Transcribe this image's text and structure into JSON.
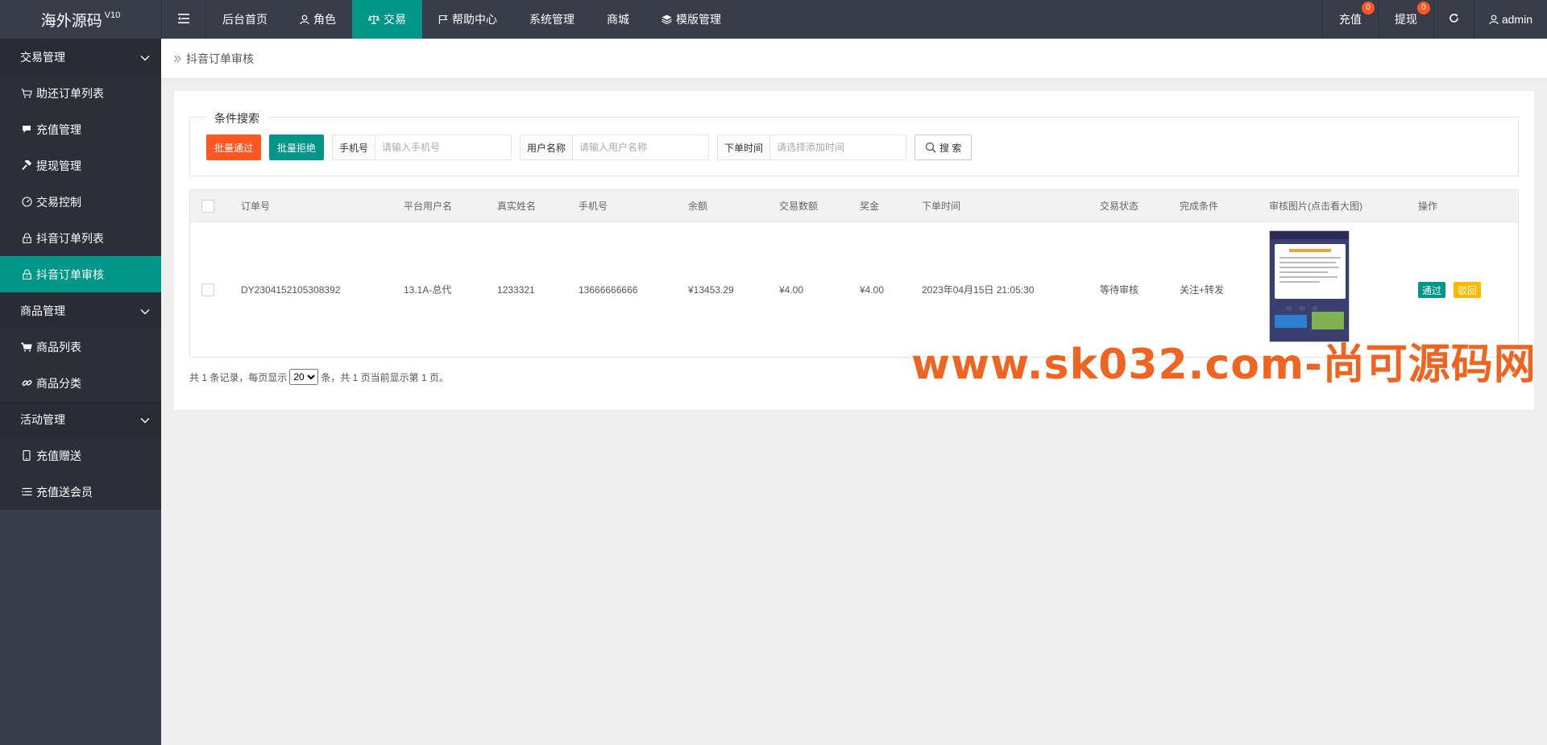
{
  "header": {
    "logo": "海外源码",
    "version": "V10",
    "nav": [
      {
        "label": "后台首页",
        "icon": ""
      },
      {
        "label": "角色",
        "icon": "user-icon"
      },
      {
        "label": "交易",
        "icon": "scale-icon",
        "active": true
      },
      {
        "label": "帮助中心",
        "icon": "flag-icon"
      },
      {
        "label": "系统管理",
        "icon": ""
      },
      {
        "label": "商城",
        "icon": ""
      },
      {
        "label": "模版管理",
        "icon": "layers-icon"
      }
    ],
    "recharge_label": "充值",
    "recharge_badge": "0",
    "withdraw_label": "提现",
    "withdraw_badge": "0",
    "user_label": "admin"
  },
  "sidebar": {
    "groups": [
      {
        "title": "交易管理",
        "items": [
          {
            "label": "助还订单列表",
            "icon": "cart-icon"
          },
          {
            "label": "充值管理",
            "icon": "chat-icon"
          },
          {
            "label": "提现管理",
            "icon": "hammer-icon"
          },
          {
            "label": "交易控制",
            "icon": "gauge-icon"
          },
          {
            "label": "抖音订单列表",
            "icon": "lock-icon"
          },
          {
            "label": "抖音订单审核",
            "icon": "lock-icon",
            "active": true
          }
        ]
      },
      {
        "title": "商品管理",
        "items": [
          {
            "label": "商品列表",
            "icon": "cart-icon"
          },
          {
            "label": "商品分类",
            "icon": "link-icon"
          }
        ]
      },
      {
        "title": "活动管理",
        "items": [
          {
            "label": "充值赠送",
            "icon": "phone-icon"
          },
          {
            "label": "充值送会员",
            "icon": "list-icon"
          }
        ]
      }
    ]
  },
  "breadcrumb": "抖音订单审核",
  "search": {
    "legend": "条件搜索",
    "batch_pass": "批量通过",
    "batch_reject": "批量拒绝",
    "phone_label": "手机号",
    "phone_placeholder": "请输入手机号",
    "username_label": "用户名称",
    "username_placeholder": "请输入用户名称",
    "time_label": "下单时间",
    "time_placeholder": "请选择添加时间",
    "search_button": "搜 索"
  },
  "table": {
    "columns": [
      "订单号",
      "平台用户名",
      "真实姓名",
      "手机号",
      "余额",
      "交易数额",
      "奖金",
      "下单时间",
      "交易状态",
      "完成条件",
      "审核图片(点击看大图)",
      "操作"
    ],
    "rows": [
      {
        "order_no": "DY2304152105308392",
        "platform_user": "13.1A-总代",
        "real_name": "1233321",
        "phone": "13666666666",
        "balance": "¥13453.29",
        "amount": "¥4.00",
        "bonus": "¥4.00",
        "order_time": "2023年04月15日 21:05:30",
        "status": "等待审核",
        "condition": "关注+转发",
        "pass_label": "通过",
        "reject_label": "驳回"
      }
    ]
  },
  "pager": {
    "prefix": "共 1 条记录，每页显示",
    "page_size": "20",
    "suffix": "条，共 1 页当前显示第 1 页。"
  },
  "watermark": "www.sk032.com-尚可源码网",
  "colors": {
    "header_bg": "#393d49",
    "accent": "#009688",
    "danger": "#ff5722",
    "warning": "#ffb800"
  }
}
